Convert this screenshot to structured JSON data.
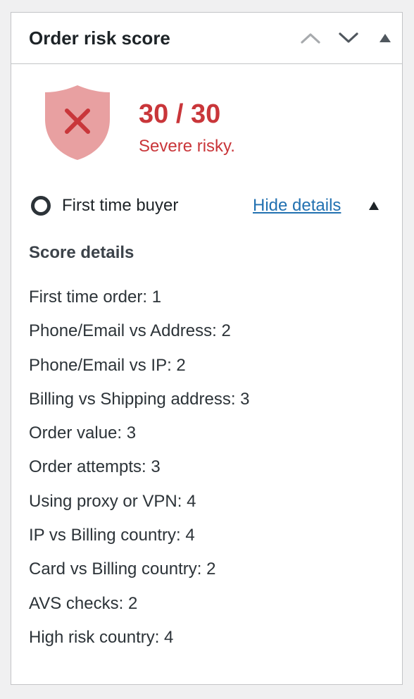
{
  "panel": {
    "title": "Order risk score",
    "controls": {
      "move_up_icon": "chevron-up-icon",
      "move_down_icon": "chevron-down-icon",
      "toggle_icon": "triangle-up-icon"
    }
  },
  "risk": {
    "score_text": "30 / 30",
    "label": "Severe risky.",
    "icon": "shield-x-icon",
    "colors": {
      "accent": "#c9363a",
      "shield_fill": "#e8a0a1",
      "x_mark": "#c9363a"
    }
  },
  "buyer": {
    "status_icon": "circle-outline-icon",
    "text": "First time buyer",
    "hide_details_label": "Hide details",
    "toggle_icon": "triangle-up-icon",
    "link_color": "#2271b1"
  },
  "details": {
    "title": "Score details",
    "items": [
      {
        "text": "First time order: 1"
      },
      {
        "text": "Phone/Email vs Address: 2"
      },
      {
        "text": "Phone/Email vs IP: 2"
      },
      {
        "text": "Billing vs Shipping address: 3"
      },
      {
        "text": "Order value: 3"
      },
      {
        "text": "Order attempts: 3"
      },
      {
        "text": "Using proxy or VPN: 4"
      },
      {
        "text": "IP vs Billing country: 4"
      },
      {
        "text": "Card vs Billing country: 2"
      },
      {
        "text": "AVS checks: 2"
      },
      {
        "text": "High risk country: 4"
      }
    ]
  }
}
